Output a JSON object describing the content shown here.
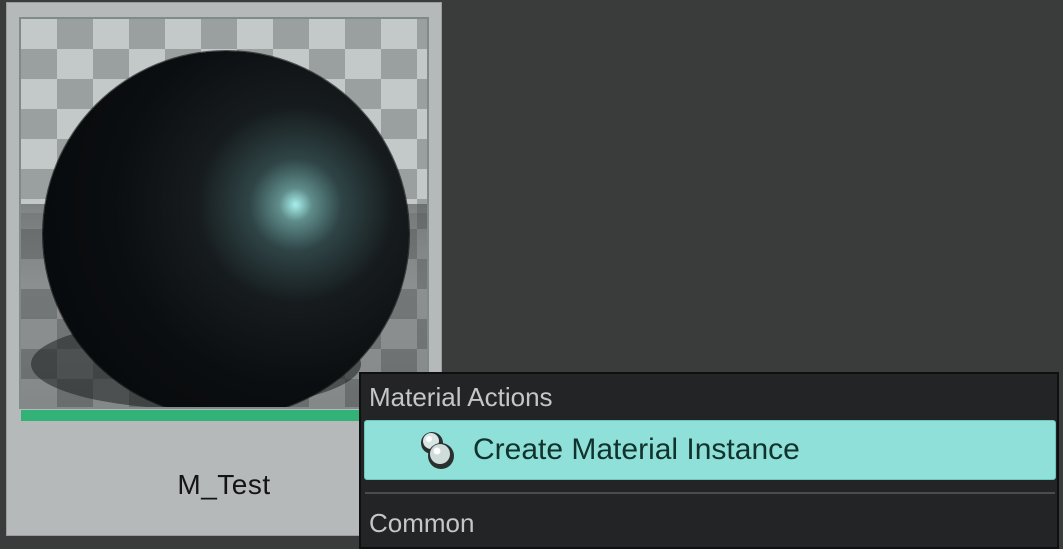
{
  "asset": {
    "name": "M_Test",
    "progress": 1.0
  },
  "context_menu": {
    "sections": [
      {
        "header": "Material Actions",
        "items": [
          {
            "label": "Create Material Instance",
            "icon": "material-instance-icon",
            "highlighted": true
          }
        ]
      },
      {
        "header": "Common",
        "items": []
      }
    ]
  },
  "colors": {
    "background": "#3a3b3b",
    "tile": "#b6b9b9",
    "highlight": "#8ee0d8",
    "progress": "#33b277",
    "menu": "#232425"
  }
}
